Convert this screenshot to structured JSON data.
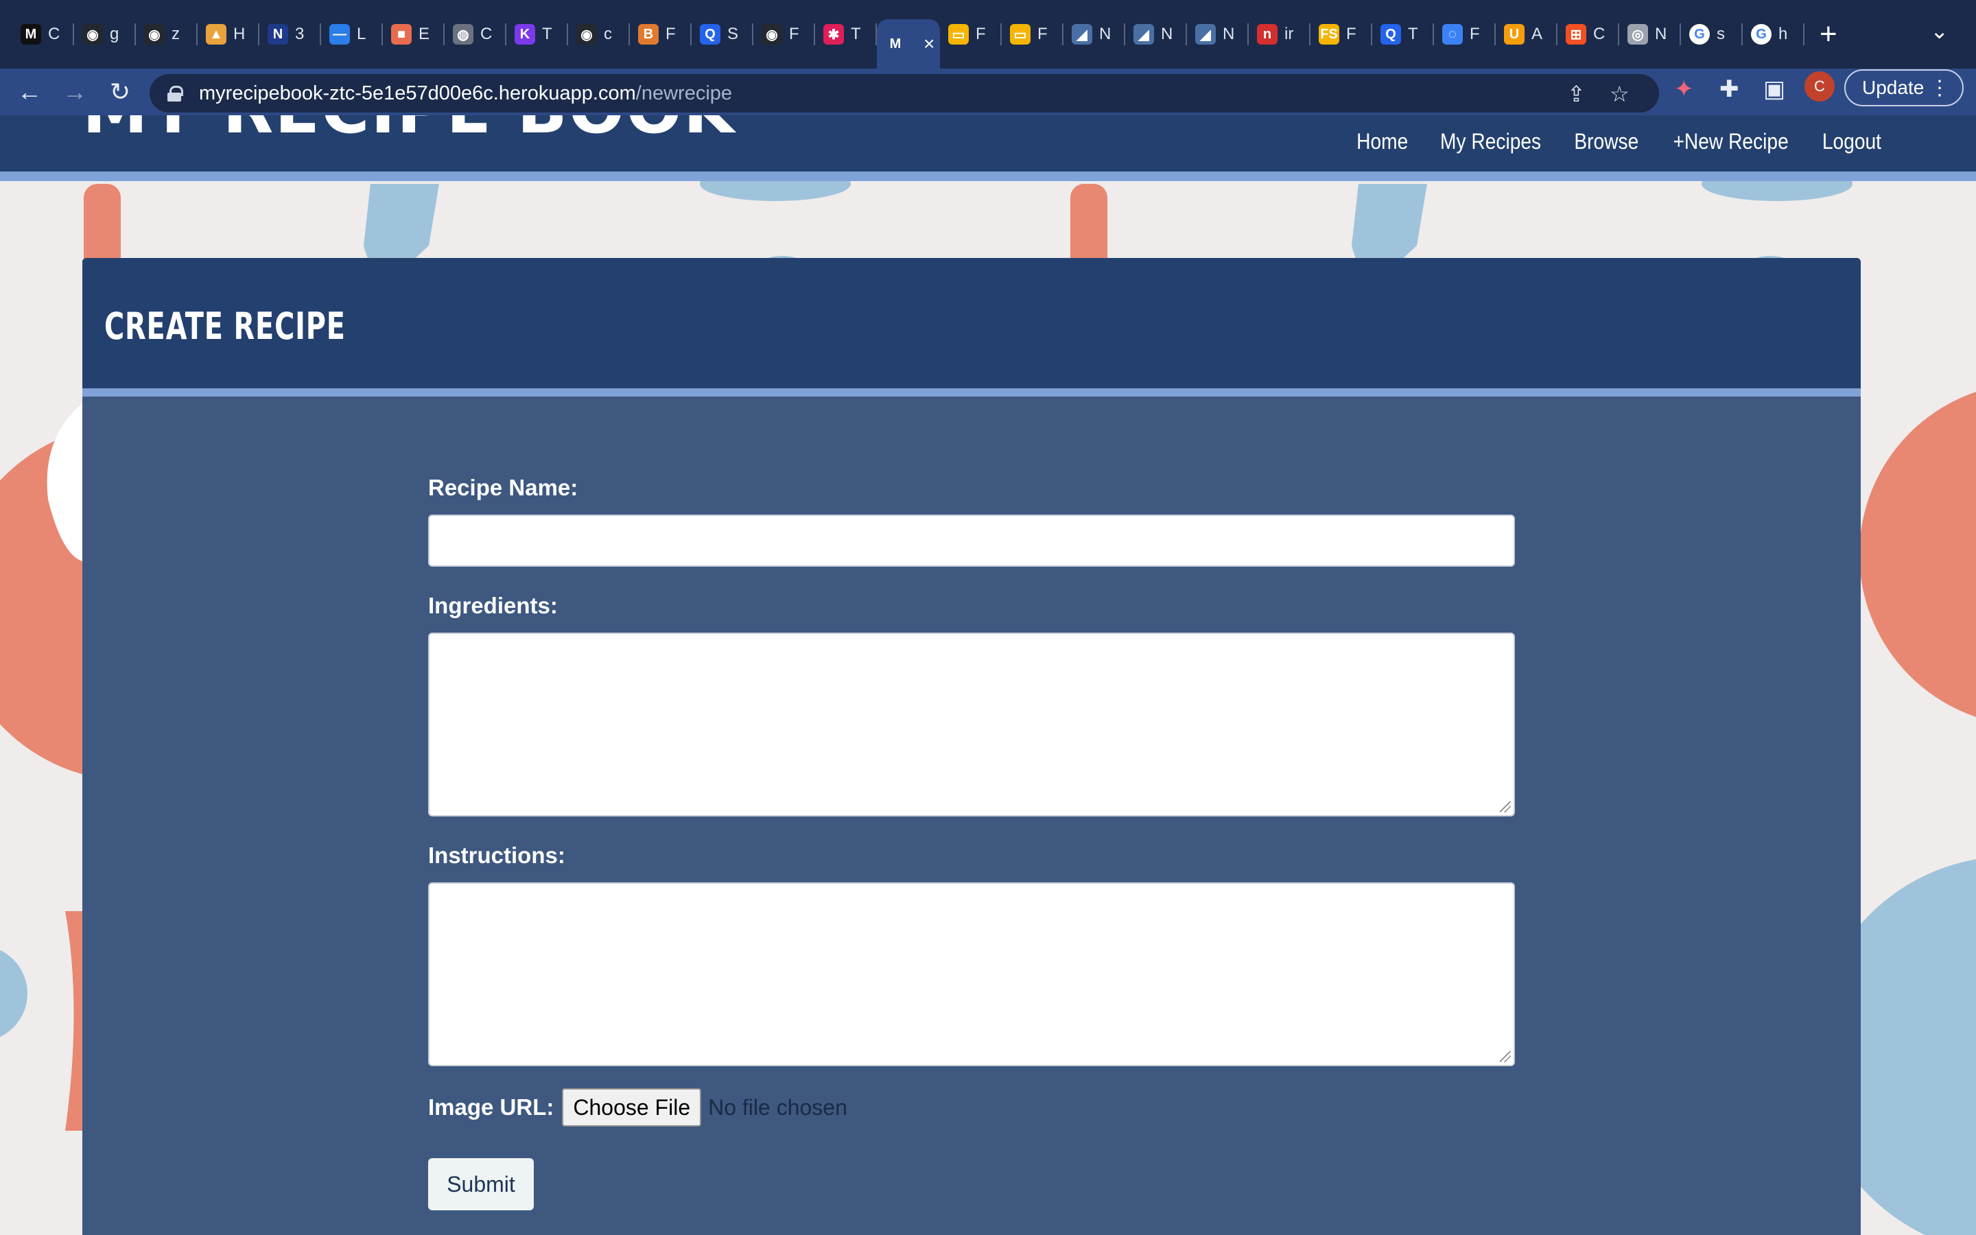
{
  "browser": {
    "tabs": [
      {
        "icon": "M",
        "label": "C",
        "color": "#111111"
      },
      {
        "icon": "◉",
        "label": "g",
        "color": "#24292f"
      },
      {
        "icon": "◉",
        "label": "z",
        "color": "#24292f"
      },
      {
        "icon": "▲",
        "label": "H",
        "color": "#e8a33d"
      },
      {
        "icon": "N",
        "label": "3",
        "color": "#1e3a8a"
      },
      {
        "icon": "—",
        "label": "L",
        "color": "#2b7de9"
      },
      {
        "icon": "■",
        "label": "E",
        "color": "#e86c4f"
      },
      {
        "icon": "◍",
        "label": "C",
        "color": "#6b7280"
      },
      {
        "icon": "K",
        "label": "T",
        "color": "#7c3aed"
      },
      {
        "icon": "◉",
        "label": "c",
        "color": "#24292f"
      },
      {
        "icon": "B",
        "label": "F",
        "color": "#e07a2e"
      },
      {
        "icon": "Q",
        "label": "S",
        "color": "#2563eb"
      },
      {
        "icon": "◉",
        "label": "F",
        "color": "#24292f"
      },
      {
        "icon": "✱",
        "label": "T",
        "color": "#e01e5a"
      },
      {
        "icon": "M",
        "label": "",
        "color": "#2d4a86",
        "active": true
      },
      {
        "icon": "▭",
        "label": "F",
        "color": "#f4b400"
      },
      {
        "icon": "▭",
        "label": "F",
        "color": "#f4b400"
      },
      {
        "icon": "◢",
        "label": "N",
        "color": "#4a6fa5"
      },
      {
        "icon": "◢",
        "label": "N",
        "color": "#4a6fa5"
      },
      {
        "icon": "◢",
        "label": "N",
        "color": "#4a6fa5"
      },
      {
        "icon": "n",
        "label": "ir",
        "color": "#d32f2f"
      },
      {
        "icon": "FS",
        "label": "F",
        "color": "#f4b400"
      },
      {
        "icon": "Q",
        "label": "T",
        "color": "#2563eb"
      },
      {
        "icon": "◌",
        "label": "F",
        "color": "#3b82f6"
      },
      {
        "icon": "U",
        "label": "A",
        "color": "#f59e0b"
      },
      {
        "icon": "⊞",
        "label": "C",
        "color": "#f25022"
      },
      {
        "icon": "◎",
        "label": "N",
        "color": "#9ca3af"
      },
      {
        "icon": "G",
        "label": "s",
        "color": "#ffffff"
      },
      {
        "icon": "G",
        "label": "h",
        "color": "#ffffff"
      }
    ],
    "new_tab": "+",
    "tab_menu": "⌄",
    "url_host": "myrecipebook-ztc-5e1e57d00e6c.herokuapp.com",
    "url_path": "/newrecipe",
    "back": "←",
    "forward": "→",
    "reload": "↻",
    "share": "⇪",
    "star": "☆",
    "extension": "✦",
    "puzzle": "✚",
    "sidebar": "▣",
    "profile_initial": "C",
    "update_label": "Update",
    "kebab": "⋮",
    "colors": {
      "tabstrip": "#1b2a4a",
      "toolbar": "#2d4a86"
    }
  },
  "site": {
    "title": "MY RECIPE BOOK",
    "nav": [
      "Home",
      "My Recipes",
      "Browse",
      "+New Recipe",
      "Logout"
    ],
    "colors": {
      "header": "#24406e",
      "accent_bar": "#7fa3d8",
      "card": "#3e5880",
      "background": "#efeceb"
    }
  },
  "form": {
    "heading": "CREATE RECIPE",
    "recipe_name_label": "Recipe Name:",
    "recipe_name_value": "",
    "ingredients_label": "Ingredients:",
    "ingredients_value": "",
    "instructions_label": "Instructions:",
    "instructions_value": "",
    "image_label": "Image URL:",
    "choose_file_label": "Choose File",
    "file_status": "No file chosen",
    "submit_label": "Submit"
  }
}
